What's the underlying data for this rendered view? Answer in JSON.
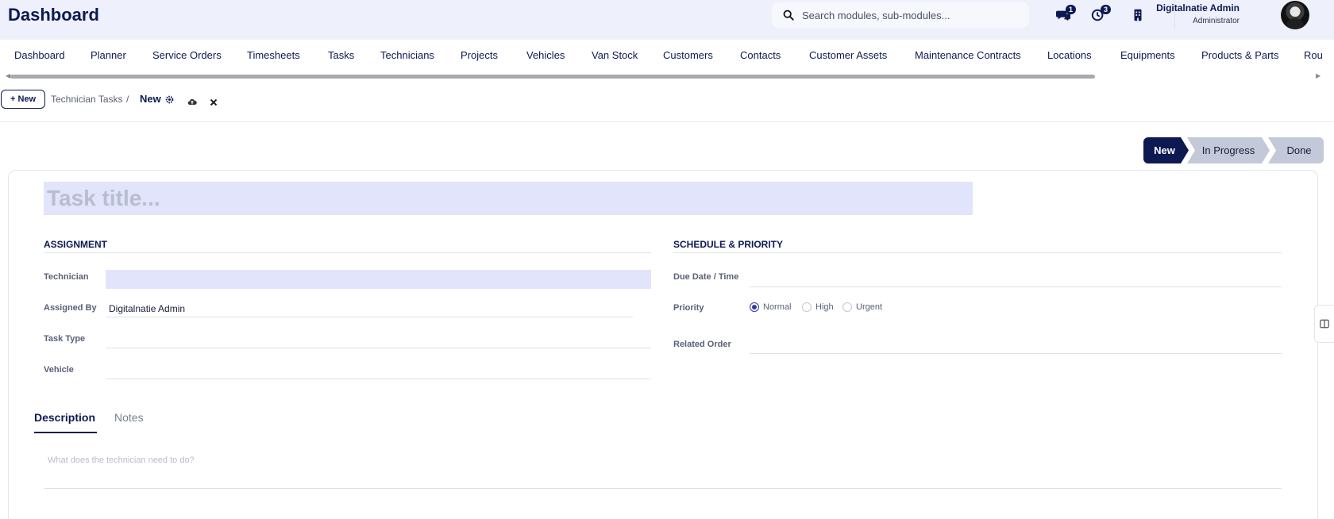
{
  "header": {
    "app_title": "Dashboard",
    "search_placeholder": "Search modules, sub-modules...",
    "messages_count": "1",
    "activity_count": "3",
    "user_name": "Digitalnatie Admin",
    "user_role": "Administrator"
  },
  "modules": [
    "Dashboard",
    "Planner",
    "Service Orders",
    "Timesheets",
    "Tasks",
    "Technicians",
    "Projects",
    "Vehicles",
    "Van Stock",
    "Customers",
    "Contacts",
    "Customer Assets",
    "Maintenance Contracts",
    "Locations",
    "Equipments",
    "Products & Parts",
    "Rou"
  ],
  "breadcrumb": {
    "new_button": "New",
    "parent": "Technician Tasks",
    "separator": "/",
    "current": "New"
  },
  "status": {
    "stages": [
      "New",
      "In Progress",
      "Done"
    ],
    "active": "New"
  },
  "form": {
    "title_placeholder": "Task title...",
    "assignment": {
      "heading": "ASSIGNMENT",
      "technician_label": "Technician",
      "technician_value": "",
      "assigned_by_label": "Assigned By",
      "assigned_by_value": "Digitalnatie Admin",
      "task_type_label": "Task Type",
      "task_type_value": "",
      "vehicle_label": "Vehicle",
      "vehicle_value": ""
    },
    "schedule": {
      "heading": "SCHEDULE & PRIORITY",
      "due_label": "Due Date / Time",
      "due_value": "",
      "priority_label": "Priority",
      "priority_options": [
        "Normal",
        "High",
        "Urgent"
      ],
      "priority_selected": "Normal",
      "related_label": "Related Order",
      "related_value": ""
    },
    "tabs": [
      "Description",
      "Notes"
    ],
    "active_tab": "Description",
    "description_placeholder": "What does the technician need to do?"
  },
  "colors": {
    "brand": "#0d1a52",
    "header_bg": "#eef1fc",
    "highlight_field": "#e1e4fb",
    "stage_inactive": "#c3c9d9"
  }
}
